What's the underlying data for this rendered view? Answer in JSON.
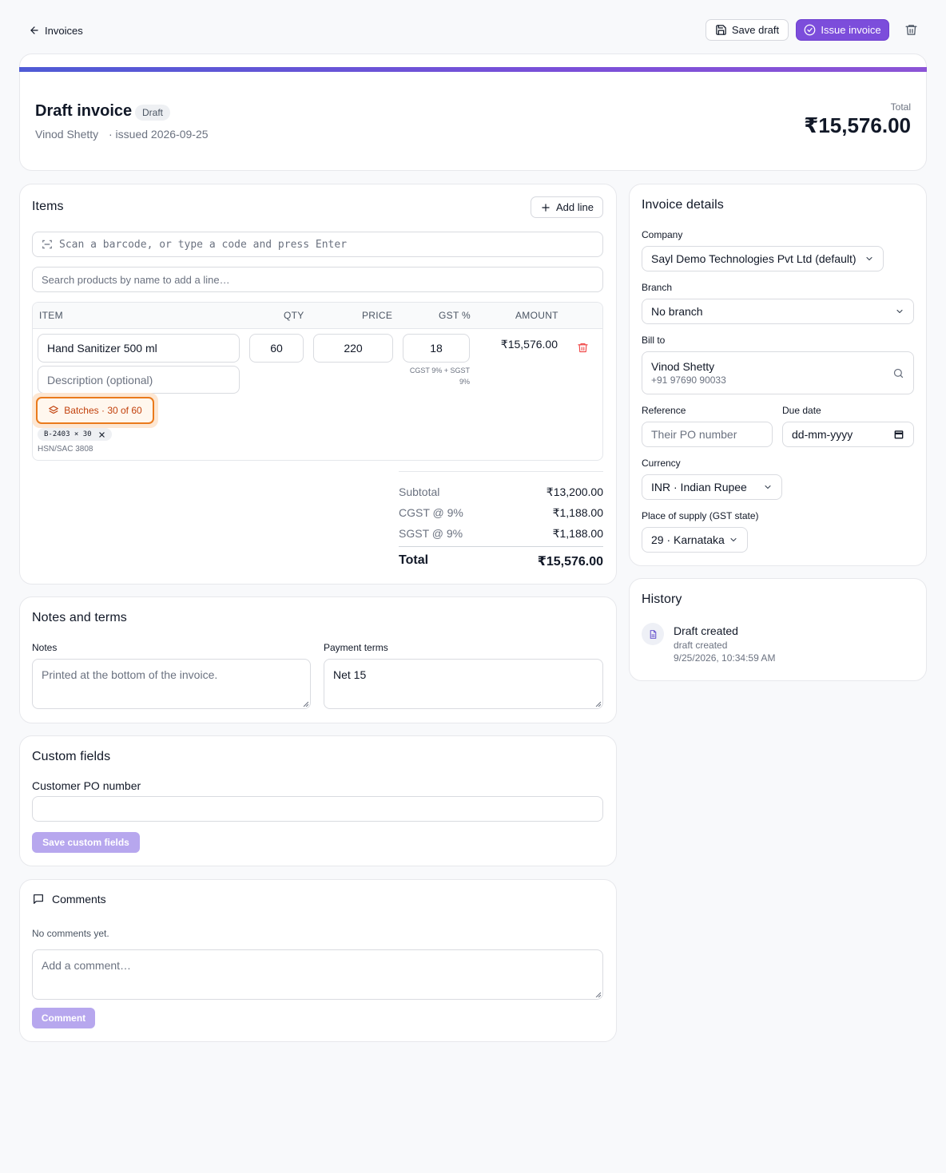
{
  "topbar": {
    "back_label": "Invoices",
    "save_draft_label": "Save draft",
    "issue_label": "Issue invoice"
  },
  "header": {
    "title": "Draft invoice",
    "status": "Draft",
    "customer": "Vinod Shetty",
    "issued": "· issued 2026-09-25",
    "total_label": "Total",
    "total_value": "₹15,576.00",
    "accent_colors": [
      "#4f5bd5",
      "#8c54d6"
    ]
  },
  "items": {
    "title": "Items",
    "add_line_label": "Add line",
    "barcode_placeholder": "Scan a barcode, or type a code and press Enter",
    "search_placeholder": "Search products by name to add a line…",
    "columns": [
      "ITEM",
      "QTY",
      "PRICE",
      "GST %",
      "AMOUNT"
    ],
    "lines": [
      {
        "name": "Hand Sanitizer 500 ml",
        "description_placeholder": "Description (optional)",
        "qty": "60",
        "price": "220",
        "gst": "18",
        "gst_note": "CGST 9% + SGST 9%",
        "amount": "₹15,576.00",
        "batches_label": "Batches · 30 of 60",
        "batch_chip": "B-2403 × 30",
        "hsn": "HSN/SAC 3808"
      }
    ],
    "summary": {
      "subtotal_label": "Subtotal",
      "subtotal_value": "₹13,200.00",
      "cgst_label": "CGST @ 9%",
      "cgst_value": "₹1,188.00",
      "sgst_label": "SGST @ 9%",
      "sgst_value": "₹1,188.00",
      "total_label": "Total",
      "total_value": "₹15,576.00"
    }
  },
  "details": {
    "title": "Invoice details",
    "company_label": "Company",
    "company_value": "Sayl Demo Technologies Pvt Ltd (default)",
    "branch_label": "Branch",
    "branch_value": "No branch",
    "bill_to_label": "Bill to",
    "bill_to_name": "Vinod Shetty",
    "bill_to_phone": "+91 97690 90033",
    "reference_label": "Reference",
    "reference_placeholder": "Their PO number",
    "due_label": "Due date",
    "due_placeholder": "dd-mm-yyyy",
    "currency_label": "Currency",
    "currency_value": "INR · Indian Rupee",
    "supply_label": "Place of supply (GST state)",
    "supply_value": "29 · Karnataka"
  },
  "history": {
    "title": "History",
    "entries": [
      {
        "title": "Draft created",
        "subtitle": "draft created",
        "time": "9/25/2026, 10:34:59 AM"
      }
    ]
  },
  "notes": {
    "title": "Notes and terms",
    "notes_label": "Notes",
    "notes_placeholder": "Printed at the bottom of the invoice.",
    "terms_label": "Payment terms",
    "terms_value": "Net 15"
  },
  "custom": {
    "title": "Custom fields",
    "po_label": "Customer PO number",
    "save_label": "Save custom fields"
  },
  "comments": {
    "title": "Comments",
    "empty": "No comments yet.",
    "placeholder": "Add a comment…",
    "submit_label": "Comment"
  }
}
